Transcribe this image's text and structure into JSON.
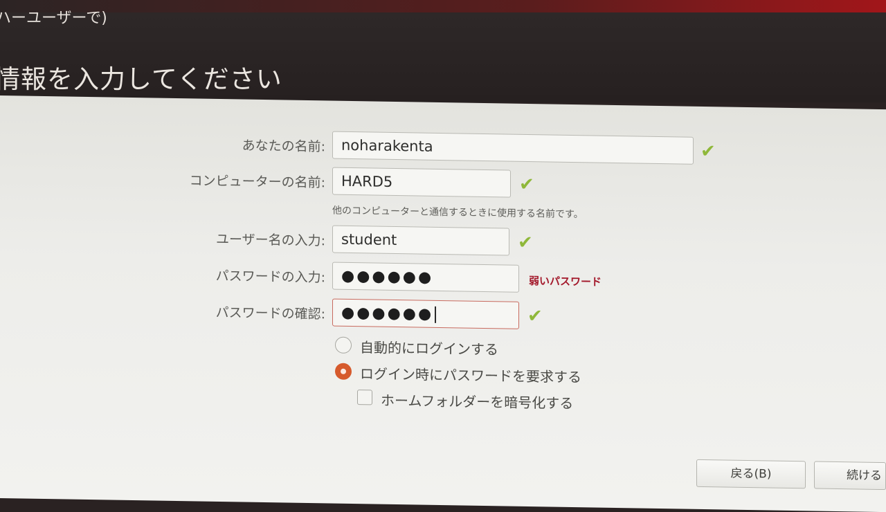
{
  "window": {
    "title": "ハーユーザーで)"
  },
  "header": {
    "title": "情報を入力してください"
  },
  "form": {
    "name_label": "あなたの名前:",
    "name_value": "noharakenta",
    "computer_label": "コンピューターの名前:",
    "computer_value": "HARD5",
    "computer_hint": "他のコンピューターと通信するときに使用する名前です。",
    "username_label": "ユーザー名の入力:",
    "username_value": "student",
    "password_label": "パスワードの入力:",
    "password_value": "●●●●●●",
    "password_strength": "弱いパスワード",
    "confirm_label": "パスワードの確認:",
    "confirm_value": "●●●●●●"
  },
  "options": {
    "auto_login_label": "自動的にログインする",
    "auto_login_selected": false,
    "require_password_label": "ログイン時にパスワードを要求する",
    "require_password_selected": true,
    "encrypt_home_label": "ホームフォルダーを暗号化する",
    "encrypt_home_checked": false
  },
  "buttons": {
    "back_label": "戻る(B)",
    "continue_label": "続ける"
  },
  "icons": {
    "valid": "check-icon"
  },
  "colors": {
    "accent": "#d65a2c",
    "check": "#8fb83a",
    "warning": "#a3182a"
  }
}
